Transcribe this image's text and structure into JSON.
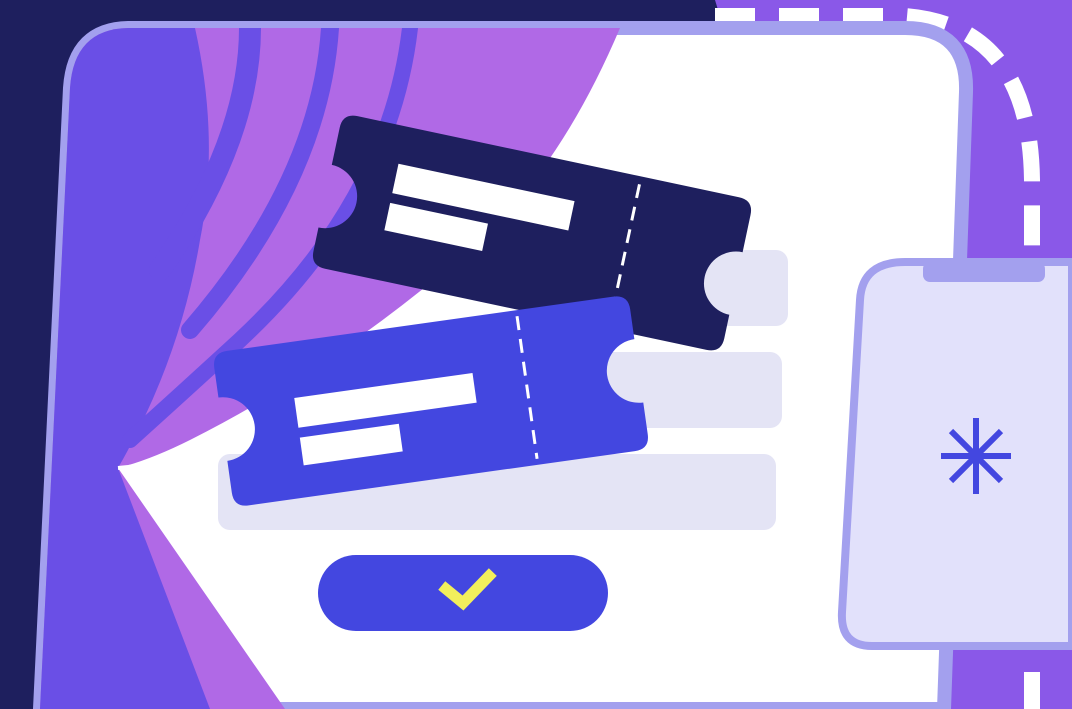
{
  "illustration": {
    "theme": "theater-tickets-purchase",
    "icons": {
      "confirm": "checkmark-icon",
      "phone_symbol": "asterisk-icon"
    },
    "colors": {
      "navy": "#1e1f5e",
      "violet_bg": "#8a58e8",
      "frame_border": "#a3a0ee",
      "curtain_main": "#6a4fe6",
      "curtain_light": "#b069e6",
      "ticket_dark": "#1e1f5e",
      "ticket_blue": "#4347e0",
      "field_gray": "#e4e4f5",
      "button": "#4347e0",
      "check_yellow": "#f2ef5c",
      "phone_screen": "#e2e1fb",
      "white": "#ffffff"
    }
  }
}
